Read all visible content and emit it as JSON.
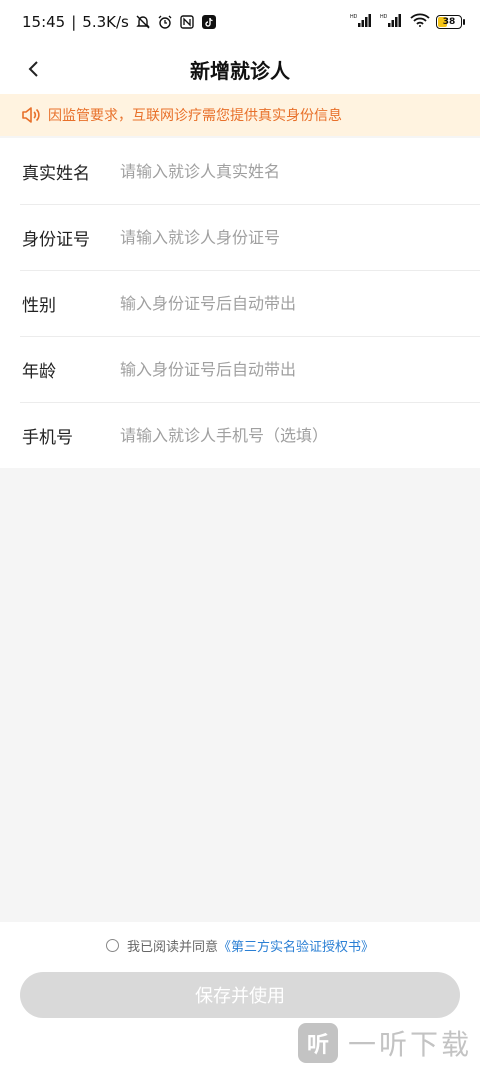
{
  "status": {
    "time": "15:45",
    "speed": "5.3K/s",
    "battery": "38"
  },
  "nav": {
    "title": "新增就诊人"
  },
  "notice": {
    "text": "因监管要求，互联网诊疗需您提供真实身份信息"
  },
  "form": {
    "fields": [
      {
        "label": "真实姓名",
        "placeholder": "请输入就诊人真实姓名"
      },
      {
        "label": "身份证号",
        "placeholder": "请输入就诊人身份证号"
      },
      {
        "label": "性别",
        "placeholder": "输入身份证号后自动带出"
      },
      {
        "label": "年龄",
        "placeholder": "输入身份证号后自动带出"
      },
      {
        "label": "手机号",
        "placeholder": "请输入就诊人手机号（选填）"
      }
    ]
  },
  "agreement": {
    "prefix": "我已阅读并同意",
    "link": "《第三方实名验证授权书》"
  },
  "actions": {
    "save_label": "保存并使用"
  },
  "watermark": {
    "logo": "听",
    "text": "一听下载"
  },
  "colors": {
    "notice_bg": "#fff3e0",
    "notice_text": "#e8702a",
    "link": "#2a7fd4",
    "button_disabled": "#d9d9d9"
  },
  "icons": [
    "back-arrow-icon",
    "mute-bell-icon",
    "alarm-icon",
    "nfc-icon",
    "tiktok-icon",
    "signal-icon",
    "wifi-icon",
    "battery-icon",
    "speaker-icon",
    "radio-icon"
  ]
}
